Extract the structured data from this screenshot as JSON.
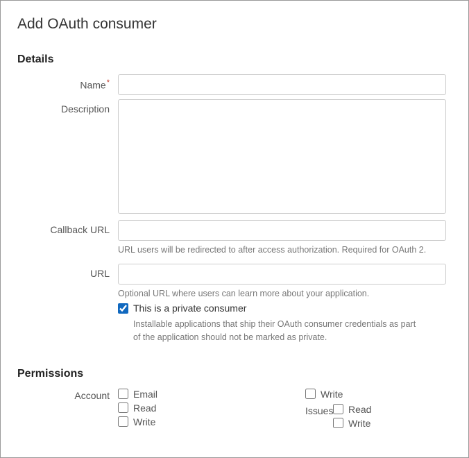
{
  "page": {
    "title": "Add OAuth consumer"
  },
  "sections": {
    "details": "Details",
    "permissions": "Permissions"
  },
  "fields": {
    "name": {
      "label": "Name",
      "value": "",
      "required": true
    },
    "description": {
      "label": "Description",
      "value": ""
    },
    "callback": {
      "label": "Callback URL",
      "value": "",
      "help": "URL users will be redirected to after access authorization. Required for OAuth 2."
    },
    "url": {
      "label": "URL",
      "value": "",
      "help": "Optional URL where users can learn more about your application."
    },
    "private": {
      "label": "This is a private consumer",
      "checked": true,
      "help": "Installable applications that ship their OAuth consumer credentials as part of the application should not be marked as private."
    }
  },
  "permissions": {
    "account": {
      "label": "Account",
      "options": [
        {
          "key": "email",
          "label": "Email",
          "checked": false
        },
        {
          "key": "read",
          "label": "Read",
          "checked": false
        },
        {
          "key": "write",
          "label": "Write",
          "checked": false
        }
      ]
    },
    "right_top": {
      "options": [
        {
          "key": "write",
          "label": "Write",
          "checked": false
        }
      ]
    },
    "issues": {
      "label": "Issues",
      "options": [
        {
          "key": "read",
          "label": "Read",
          "checked": false
        },
        {
          "key": "write",
          "label": "Write",
          "checked": false
        }
      ]
    }
  }
}
